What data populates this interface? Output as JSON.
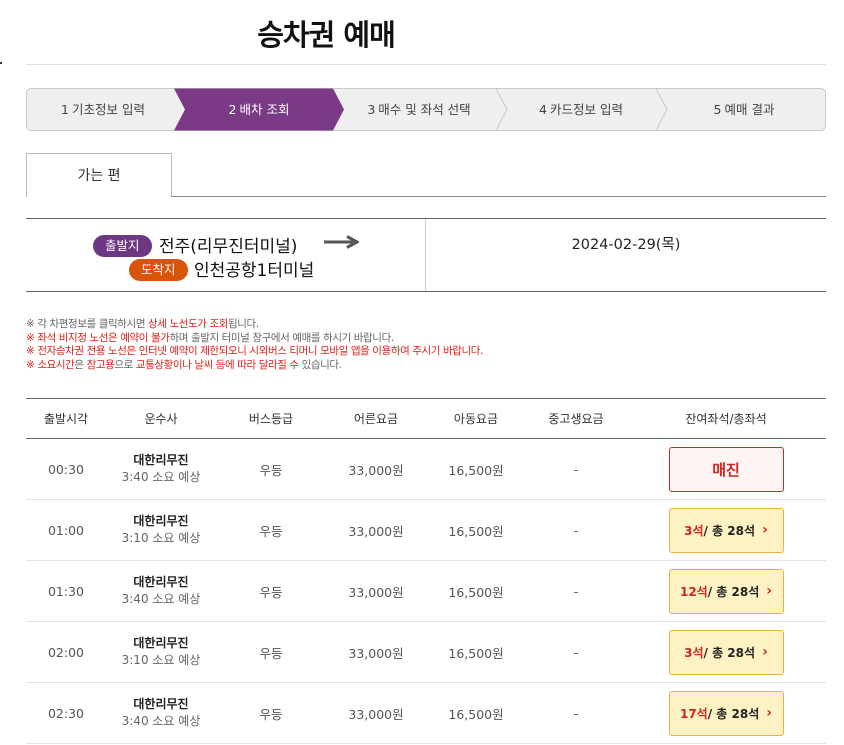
{
  "page": {
    "title": "승차권 예매"
  },
  "steps": [
    {
      "num": "1",
      "label": "기초정보 입력"
    },
    {
      "num": "2",
      "label": "배차 조회"
    },
    {
      "num": "3",
      "label": "매수 및 좌석 선택"
    },
    {
      "num": "4",
      "label": "카드정보 입력"
    },
    {
      "num": "5",
      "label": "예매 결과"
    }
  ],
  "active_step": 2,
  "tab": {
    "label": "가는 편"
  },
  "route": {
    "departure_badge": "출발지",
    "departure": "전주(리무진터미널)",
    "arrival_badge": "도착지",
    "arrival": "인천공항1터미널",
    "date": "2024-02-29(목)"
  },
  "notices": {
    "n1": {
      "mark": "※",
      "a": " 각 차편정보를 클릭하시면 ",
      "b": "상세 노선도가 조회",
      "c": "됩니다."
    },
    "n2": {
      "mark": "※",
      "a": " 좌석 비지정 노선은 예약이 불가",
      "b": "하며 출발지 터미널 창구에서 예매를 하시기 바랍니다."
    },
    "n3": {
      "mark": "※",
      "a": " 전자승차권 전용 노선은 인터넷 예약이 제한되오니 시외버스 티머니 모바일 앱을 이용하여 주시기 바랍니다."
    },
    "n4": {
      "mark": "※",
      "a": " 소요시간",
      "b": "은 ",
      "c": "참고용",
      "d": "으로 ",
      "e": "교통상황이나 날씨 등에 따라 달라질 수 ",
      "f": "있습니다."
    }
  },
  "table": {
    "headers": {
      "time": "출발시각",
      "company": "운수사",
      "grade": "버스등급",
      "adult": "어른요금",
      "child": "아동요금",
      "youth": "중고생요금",
      "seats": "잔여좌석/총좌석"
    },
    "rows": [
      {
        "time": "00:30",
        "company": "대한리무진",
        "duration": "3:40 소요 예상",
        "grade": "우등",
        "adult": "33,000원",
        "child": "16,500원",
        "youth": "-",
        "soldout": "매진"
      },
      {
        "time": "01:00",
        "company": "대한리무진",
        "duration": "3:10 소요 예상",
        "grade": "우등",
        "adult": "33,000원",
        "child": "16,500원",
        "youth": "-",
        "seats_left": "3석",
        "seats_total": " / 총 28석"
      },
      {
        "time": "01:30",
        "company": "대한리무진",
        "duration": "3:40 소요 예상",
        "grade": "우등",
        "adult": "33,000원",
        "child": "16,500원",
        "youth": "-",
        "seats_left": "12석",
        "seats_total": " / 총 28석"
      },
      {
        "time": "02:00",
        "company": "대한리무진",
        "duration": "3:10 소요 예상",
        "grade": "우등",
        "adult": "33,000원",
        "child": "16,500원",
        "youth": "-",
        "seats_left": "3석",
        "seats_total": " / 총 28석"
      },
      {
        "time": "02:30",
        "company": "대한리무진",
        "duration": "3:40 소요 예상",
        "grade": "우등",
        "adult": "33,000원",
        "child": "16,500원",
        "youth": "-",
        "seats_left": "17석",
        "seats_total": " / 총 28석"
      }
    ]
  },
  "colors": {
    "active_step": "#7b3a86",
    "departure_badge": "#6e3784",
    "arrival_badge": "#d9540b",
    "soldout": "#d32424",
    "seat_button_bg": "#fdf2c3",
    "seat_button_border": "#e9b34c"
  },
  "icons": {
    "arrow": "long-right-arrow-icon",
    "chevron": "chevron-right-icon"
  }
}
